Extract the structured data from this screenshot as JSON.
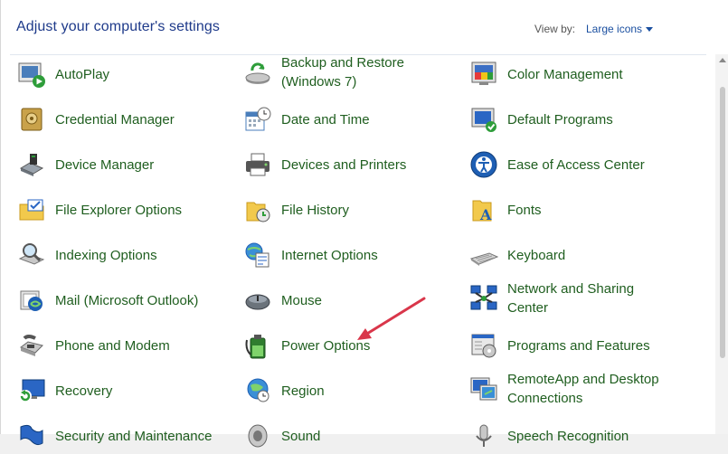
{
  "header": {
    "title": "Adjust your computer's settings",
    "view_by_label": "View by:",
    "view_by_value": "Large icons"
  },
  "items": [
    {
      "label": "AutoPlay",
      "icon": "autoplay-icon"
    },
    {
      "label": "Backup and Restore\n(Windows 7)",
      "icon": "backup-icon"
    },
    {
      "label": "Color Management",
      "icon": "color-management-icon"
    },
    {
      "label": "Credential Manager",
      "icon": "credential-manager-icon"
    },
    {
      "label": "Date and Time",
      "icon": "calendar-clock-icon"
    },
    {
      "label": "Default Programs",
      "icon": "default-programs-icon"
    },
    {
      "label": "Device Manager",
      "icon": "device-manager-icon"
    },
    {
      "label": "Devices and Printers",
      "icon": "printer-icon"
    },
    {
      "label": "Ease of Access Center",
      "icon": "ease-of-access-icon"
    },
    {
      "label": "File Explorer Options",
      "icon": "folder-options-icon"
    },
    {
      "label": "File History",
      "icon": "file-history-icon"
    },
    {
      "label": "Fonts",
      "icon": "fonts-icon"
    },
    {
      "label": "Indexing Options",
      "icon": "indexing-icon"
    },
    {
      "label": "Internet Options",
      "icon": "internet-options-icon"
    },
    {
      "label": "Keyboard",
      "icon": "keyboard-icon"
    },
    {
      "label": "Mail (Microsoft Outlook)",
      "icon": "mail-icon"
    },
    {
      "label": "Mouse",
      "icon": "mouse-icon"
    },
    {
      "label": "Network and Sharing\nCenter",
      "icon": "network-icon"
    },
    {
      "label": "Phone and Modem",
      "icon": "phone-modem-icon"
    },
    {
      "label": "Power Options",
      "icon": "power-options-icon"
    },
    {
      "label": "Programs and Features",
      "icon": "programs-features-icon"
    },
    {
      "label": "Recovery",
      "icon": "recovery-icon"
    },
    {
      "label": "Region",
      "icon": "region-globe-icon"
    },
    {
      "label": "RemoteApp and Desktop\nConnections",
      "icon": "remoteapp-icon"
    },
    {
      "label": "Security and Maintenance",
      "icon": "security-flag-icon"
    },
    {
      "label": "Sound",
      "icon": "speaker-icon"
    },
    {
      "label": "Speech Recognition",
      "icon": "microphone-icon"
    }
  ],
  "colors": {
    "title": "#1e3a8a",
    "link": "#1f5e1f",
    "accent": "#1a4fa0",
    "annotation_arrow": "#d9364a"
  }
}
